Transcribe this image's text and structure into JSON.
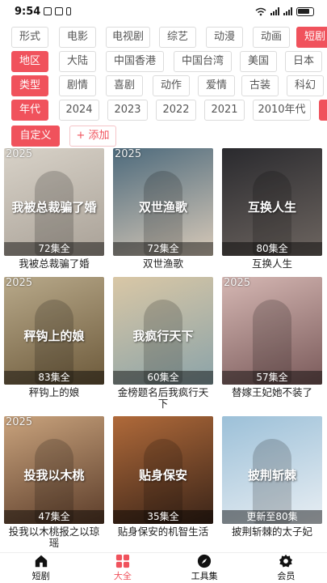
{
  "status_bar": {
    "time": "9:54"
  },
  "filters": {
    "form": {
      "items": [
        "形式",
        "电影",
        "电视剧",
        "综艺",
        "动漫",
        "动画",
        "短剧"
      ],
      "selected": "短剧"
    },
    "region": {
      "label": "地区",
      "items": [
        "大陆",
        "中国香港",
        "中国台湾",
        "美国",
        "日本"
      ]
    },
    "type": {
      "label": "类型",
      "items": [
        "剧情",
        "喜剧",
        "动作",
        "爱情",
        "古装",
        "科幻"
      ]
    },
    "year": {
      "label": "年代",
      "items": [
        "2024",
        "2023",
        "2022",
        "2021",
        "2010年代"
      ]
    },
    "custom": {
      "label": "自定义",
      "add": "+ 添加"
    }
  },
  "cards": [
    {
      "year": "2025",
      "episodes": "72集全",
      "title": "我被总裁骗了婚",
      "art": "我被总裁骗了婚",
      "colors": [
        "#d8d2c8",
        "#a9a197"
      ]
    },
    {
      "year": "2025",
      "episodes": "72集全",
      "title": "双世渔歌",
      "art": "双世渔歌",
      "colors": [
        "#4d6a7c",
        "#d7c9b8"
      ]
    },
    {
      "year": "",
      "episodes": "80集全",
      "title": "互换人生",
      "art": "互换人生",
      "colors": [
        "#2a2a2e",
        "#6d6560"
      ]
    },
    {
      "year": "2025",
      "episodes": "83集全",
      "title": "秤钩上的娘",
      "art": "秤钩上的娘",
      "colors": [
        "#b8a98a",
        "#6d5a3b"
      ]
    },
    {
      "year": "",
      "episodes": "60集全",
      "title": "金榜题名后我疯行天下",
      "art": "我疯行天下",
      "colors": [
        "#d9c7a6",
        "#8ba3a8"
      ]
    },
    {
      "year": "2025",
      "episodes": "57集全",
      "title": "替嫁王妃她不装了",
      "art": "",
      "colors": [
        "#d5b7b3",
        "#7a5a5a"
      ]
    },
    {
      "year": "2025",
      "episodes": "47集全",
      "title": "投我以木桃报之以琼瑶",
      "art": "投我以木桃",
      "colors": [
        "#c9a37d",
        "#5c3d2a"
      ]
    },
    {
      "year": "",
      "episodes": "35集全",
      "title": "贴身保安的机智生活",
      "art": "贴身保安",
      "colors": [
        "#b06a3a",
        "#3a2418"
      ]
    },
    {
      "year": "",
      "episodes": "更新至80集",
      "title": "披荆斩棘的太子妃",
      "art": "披荆斩棘",
      "colors": [
        "#9cc0d8",
        "#e8eef3"
      ]
    }
  ],
  "tabs": [
    {
      "label": "短剧",
      "icon": "home-icon"
    },
    {
      "label": "大全",
      "icon": "grid-icon"
    },
    {
      "label": "工具集",
      "icon": "compass-icon"
    },
    {
      "label": "会员",
      "icon": "gear-icon"
    }
  ],
  "active_tab": "大全",
  "accent_color": "#f0525c"
}
